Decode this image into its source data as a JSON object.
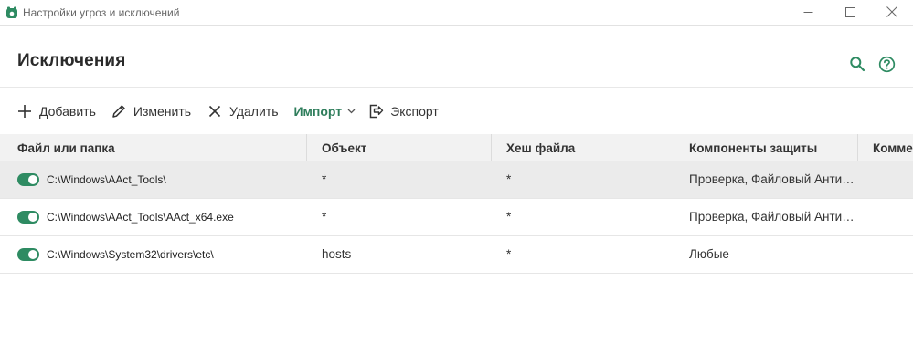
{
  "window": {
    "title": "Настройки угроз и исключений",
    "accent_color": "#2e8b62"
  },
  "header": {
    "title": "Исключения",
    "search_icon": "search-icon",
    "help_icon": "help-icon"
  },
  "toolbar": {
    "add_label": "Добавить",
    "edit_label": "Изменить",
    "delete_label": "Удалить",
    "import_label": "Импорт",
    "export_label": "Экспорт"
  },
  "table": {
    "columns": [
      "Файл или папка",
      "Объект",
      "Хеш файла",
      "Компоненты защиты",
      "Комме"
    ],
    "rows": [
      {
        "enabled": true,
        "path": "C:\\Windows\\AAct_Tools\\",
        "object": "*",
        "hash": "*",
        "components": "Проверка, Файловый Анти…",
        "comment": ""
      },
      {
        "enabled": true,
        "path": "C:\\Windows\\AAct_Tools\\AAct_x64.exe",
        "object": "*",
        "hash": "*",
        "components": "Проверка, Файловый Анти…",
        "comment": ""
      },
      {
        "enabled": true,
        "path": "C:\\Windows\\System32\\drivers\\etc\\",
        "object": "hosts",
        "hash": "*",
        "components": "Любые",
        "comment": ""
      }
    ]
  }
}
